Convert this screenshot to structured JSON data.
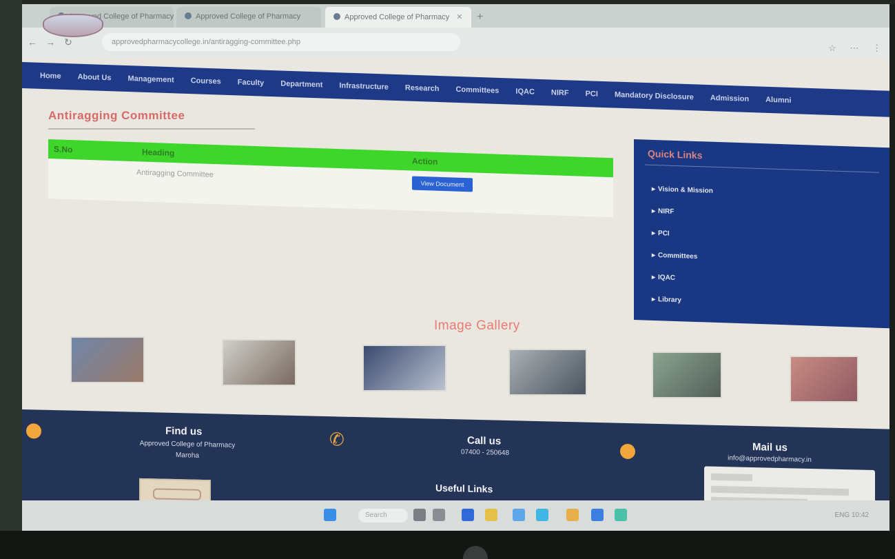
{
  "browser": {
    "tabs": [
      {
        "label": "Approved College of Pharmacy",
        "active": false
      },
      {
        "label": "Approved College of Pharmacy",
        "active": false
      },
      {
        "label": "Approved College of Pharmacy",
        "active": true
      }
    ],
    "new_tab_label": "+",
    "url": "approvedpharmacycollege.in/antiragging-committee.php"
  },
  "nav": {
    "items": [
      "Home",
      "About Us",
      "Management",
      "Courses",
      "Faculty",
      "Department",
      "Infrastructure",
      "Research",
      "Committees",
      "IQAC",
      "NIRF",
      "PCI",
      "Mandatory Disclosure",
      "Admission",
      "Alumni"
    ]
  },
  "main": {
    "title": "Antiragging Committee",
    "table": {
      "headers": [
        "S.No",
        "Heading",
        "Action"
      ],
      "rows": [
        {
          "heading": "Antiragging Committee",
          "button": "View Document"
        }
      ]
    }
  },
  "quick_links": {
    "title": "Quick Links",
    "items": [
      "Vision & Mission",
      "NIRF",
      "PCI",
      "Committees",
      "IQAC",
      "Library"
    ]
  },
  "gallery": {
    "title": "Image Gallery",
    "photos": [
      {
        "name": "campus-building",
        "colors": [
          "#6f86a8",
          "#9b7a6a"
        ]
      },
      {
        "name": "lab-session",
        "colors": [
          "#cfcfc8",
          "#7a6a62"
        ]
      },
      {
        "name": "auditorium-event",
        "colors": [
          "#3b4a6f",
          "#b9c2d0"
        ]
      },
      {
        "name": "group-photo",
        "colors": [
          "#a9b0b4",
          "#4c5560"
        ]
      },
      {
        "name": "garden-view",
        "colors": [
          "#8aa38f",
          "#53605a"
        ]
      },
      {
        "name": "students-gathering",
        "colors": [
          "#c98c84",
          "#8f5a62"
        ]
      }
    ]
  },
  "footer": {
    "find_us": {
      "heading": "Find us",
      "line1": "Approved College of Pharmacy",
      "line2": "Maroha"
    },
    "call_us": {
      "heading": "Call us",
      "line1": "07400 - 250648"
    },
    "mail_us": {
      "heading": "Mail us",
      "line1": "info@approvedpharmacy.in"
    },
    "useful_links": "Useful Links"
  },
  "taskbar": {
    "search_label": "Search",
    "tray_text": "ENG  10:42"
  },
  "colors": {
    "nav_bg": "#1e3a86",
    "table_header": "#3ed62b",
    "accent_title": "#d86a6a",
    "footer_bg": "#233457",
    "quick_bg": "#193782",
    "icon_orange": "#f0a63a"
  }
}
